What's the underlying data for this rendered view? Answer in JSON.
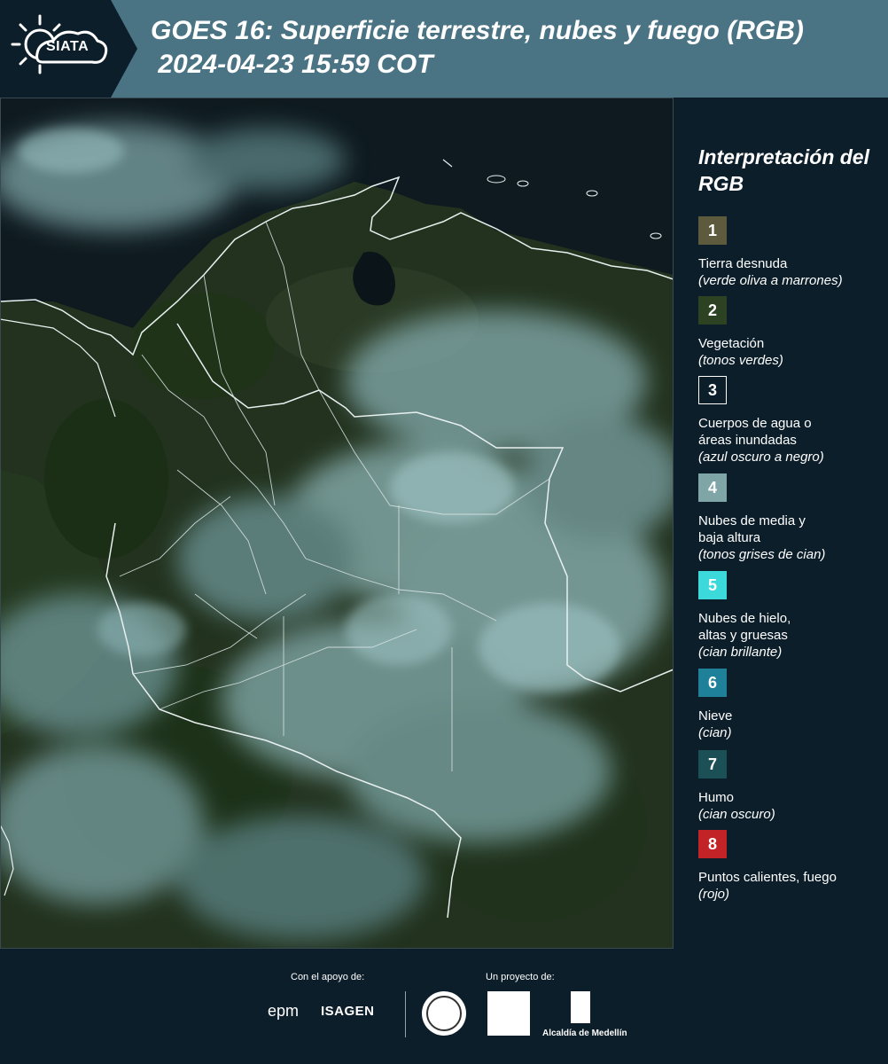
{
  "header": {
    "logo_text": "SIATA",
    "title_line1": "GOES 16: Superficie terrestre, nubes y fuego (RGB)",
    "title_line2": " 2024-04-23 15:59 COT"
  },
  "legend": {
    "title": "Interpretación del RGB",
    "items": [
      {
        "num": "1",
        "label": "Tierra desnuda",
        "desc": "(verde oliva a marrones)",
        "color": "#5e5a3e"
      },
      {
        "num": "2",
        "label": "Vegetación",
        "desc": "(tonos verdes)",
        "color": "#2d4222"
      },
      {
        "num": "3",
        "label": "Cuerpos de agua o\náreas inundadas",
        "desc": "(azul oscuro a negro)",
        "color": "#0c1e2a"
      },
      {
        "num": "4",
        "label": "Nubes de media y\nbaja altura",
        "desc": "(tonos grises de cian)",
        "color": "#7fa5a6"
      },
      {
        "num": "5",
        "label": "Nubes de hielo,\naltas y gruesas",
        "desc": "(cian brillante)",
        "color": "#3bd9da"
      },
      {
        "num": "6",
        "label": "Nieve",
        "desc": "(cian)",
        "color": "#1e8199"
      },
      {
        "num": "7",
        "label": "Humo",
        "desc": "(cian oscuro)",
        "color": "#1b5056"
      },
      {
        "num": "8",
        "label": "Puntos calientes, fuego",
        "desc": "(rojo)",
        "color": "#c12326"
      }
    ]
  },
  "footer": {
    "support_label": "Con el apoyo de:",
    "project_label": "Un proyecto de:",
    "sponsor1": "epm",
    "sponsor2": "ISAGEN",
    "partner_alcaldia": "Alcaldía de Medellín"
  }
}
